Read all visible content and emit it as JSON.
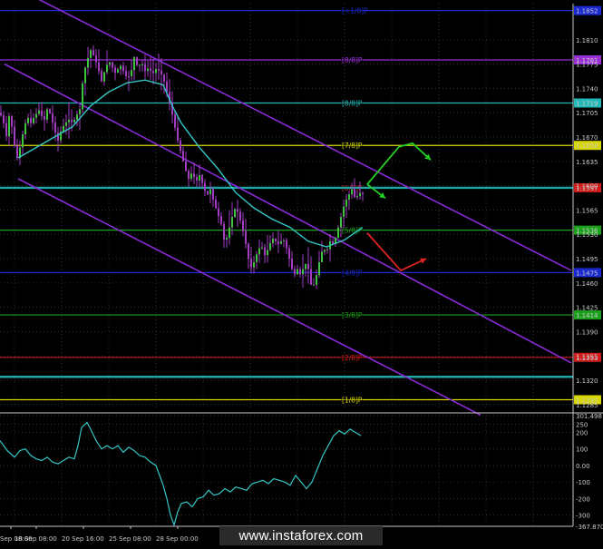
{
  "watermark": "www.instaforex.com",
  "colors": {
    "background": "#000000",
    "grid": "#2e2e2e",
    "candle": "#3cc43c",
    "candle_shadow": "#a23dc2",
    "ma": "#35c6c6",
    "channel": "#8a2bd6",
    "cci": "#35c6c6",
    "level_line": "#1fa6a6"
  },
  "chart_data": [
    {
      "type": "candlestick",
      "title": "",
      "instrument": "EUR/USD",
      "timeframe": "H4",
      "x_tick_labels": [
        "Sep 08:00",
        "18 Sep 08:00",
        "20 Sep 16:00",
        "25 Sep 08:00",
        "28 Sep 00:00"
      ],
      "y_tick_labels": [
        "1.1810",
        "1.1775",
        "1.1740",
        "1.1705",
        "1.1670",
        "1.1635",
        "1.1600",
        "1.1565",
        "1.1530",
        "1.1495",
        "1.1460",
        "1.1425",
        "1.1390",
        "1.1355",
        "1.1320",
        "1.1285"
      ],
      "ylim": [
        1.1277,
        1.1862
      ],
      "price_path": [
        [
          0,
          1.1705
        ],
        [
          4,
          1.169
        ],
        [
          8,
          1.1665
        ],
        [
          10,
          1.17
        ],
        [
          14,
          1.168
        ],
        [
          18,
          1.1635
        ],
        [
          22,
          1.1655
        ],
        [
          26,
          1.168
        ],
        [
          30,
          1.17
        ],
        [
          34,
          1.169
        ],
        [
          38,
          1.17
        ],
        [
          44,
          1.171
        ],
        [
          48,
          1.169
        ],
        [
          52,
          1.171
        ],
        [
          56,
          1.1702
        ],
        [
          60,
          1.168
        ],
        [
          64,
          1.1665
        ],
        [
          68,
          1.1682
        ],
        [
          72,
          1.169
        ],
        [
          76,
          1.1695
        ],
        [
          80,
          1.169
        ],
        [
          84,
          1.17
        ],
        [
          88,
          1.171
        ],
        [
          92,
          1.176
        ],
        [
          96,
          1.178
        ],
        [
          100,
          1.1795
        ],
        [
          104,
          1.1785
        ],
        [
          108,
          1.177
        ],
        [
          112,
          1.175
        ],
        [
          116,
          1.1768
        ],
        [
          120,
          1.178
        ],
        [
          124,
          1.177
        ],
        [
          128,
          1.176
        ],
        [
          132,
          1.1775
        ],
        [
          136,
          1.1765
        ],
        [
          140,
          1.1755
        ],
        [
          144,
          1.176
        ],
        [
          148,
          1.1785
        ],
        [
          152,
          1.177
        ],
        [
          156,
          1.1778
        ],
        [
          160,
          1.1765
        ],
        [
          164,
          1.177
        ],
        [
          168,
          1.176
        ],
        [
          172,
          1.1768
        ],
        [
          176,
          1.1765
        ],
        [
          180,
          1.1755
        ],
        [
          184,
          1.1735
        ],
        [
          188,
          1.1715
        ],
        [
          192,
          1.169
        ],
        [
          196,
          1.1665
        ],
        [
          200,
          1.1645
        ],
        [
          204,
          1.1625
        ],
        [
          208,
          1.161
        ],
        [
          212,
          1.162
        ],
        [
          216,
          1.1605
        ],
        [
          220,
          1.1615
        ],
        [
          224,
          1.16
        ],
        [
          228,
          1.1585
        ],
        [
          232,
          1.1595
        ],
        [
          236,
          1.1575
        ],
        [
          240,
          1.156
        ],
        [
          244,
          1.1545
        ],
        [
          248,
          1.1515
        ],
        [
          252,
          1.1535
        ],
        [
          256,
          1.1555
        ],
        [
          260,
          1.157
        ],
        [
          264,
          1.1555
        ],
        [
          268,
          1.1535
        ],
        [
          272,
          1.151
        ],
        [
          276,
          1.148
        ],
        [
          280,
          1.149
        ],
        [
          284,
          1.1505
        ],
        [
          288,
          1.1515
        ],
        [
          292,
          1.15
        ],
        [
          296,
          1.151
        ],
        [
          300,
          1.1525
        ],
        [
          304,
          1.152
        ],
        [
          308,
          1.1515
        ],
        [
          312,
          1.1525
        ],
        [
          316,
          1.151
        ],
        [
          320,
          1.149
        ],
        [
          324,
          1.147
        ],
        [
          328,
          1.148
        ],
        [
          332,
          1.147
        ],
        [
          336,
          1.149
        ],
        [
          340,
          1.148
        ],
        [
          344,
          1.145
        ],
        [
          348,
          1.1465
        ],
        [
          352,
          1.149
        ],
        [
          356,
          1.151
        ],
        [
          360,
          1.1505
        ],
        [
          364,
          1.152
        ],
        [
          368,
          1.1515
        ],
        [
          372,
          1.1535
        ],
        [
          376,
          1.1555
        ],
        [
          380,
          1.1575
        ],
        [
          384,
          1.1585
        ],
        [
          388,
          1.1595
        ],
        [
          392,
          1.158
        ],
        [
          396,
          1.159
        ],
        [
          400,
          1.1588
        ]
      ],
      "moving_average": [
        [
          20,
          1.164
        ],
        [
          40,
          1.1655
        ],
        [
          60,
          1.167
        ],
        [
          80,
          1.1685
        ],
        [
          100,
          1.1715
        ],
        [
          120,
          1.1735
        ],
        [
          140,
          1.1748
        ],
        [
          160,
          1.1752
        ],
        [
          180,
          1.1745
        ],
        [
          190,
          1.1715
        ],
        [
          200,
          1.169
        ],
        [
          220,
          1.1655
        ],
        [
          240,
          1.1625
        ],
        [
          260,
          1.159
        ],
        [
          280,
          1.1568
        ],
        [
          300,
          1.1552
        ],
        [
          320,
          1.154
        ],
        [
          340,
          1.152
        ],
        [
          360,
          1.1512
        ],
        [
          380,
          1.1522
        ],
        [
          400,
          1.154
        ]
      ],
      "regression_channel": {
        "upper": [
          [
            40,
            1.187
          ],
          [
            630,
            1.1478
          ]
        ],
        "middle": [
          [
            5,
            1.1775
          ],
          [
            630,
            1.1345
          ]
        ],
        "lower": [
          [
            20,
            1.161
          ],
          [
            530,
            1.127
          ]
        ]
      },
      "murrey_levels": [
        {
          "label": "[+1/8]P",
          "value": 1.1852,
          "price_label": "1.1852",
          "color": "#1a2ad0"
        },
        {
          "label": "[8/8]P",
          "value": 1.1781,
          "price_label": "1.1781",
          "color": "#9a2fd8"
        },
        {
          "label": "[8/8]P",
          "value": 1.1719,
          "price_label": "1.1719",
          "color": "#22b8b8"
        },
        {
          "label": "[7/8]P",
          "value": 1.1658,
          "price_label": "1.1658",
          "color": "#d8d800"
        },
        {
          "label": "[6/8]P",
          "value": 1.1597,
          "price_label": "1.1597",
          "color": "#d01a1a"
        },
        {
          "label": "[5/8]P",
          "value": 1.1536,
          "price_label": "1.1536",
          "color": "#1aa01a"
        },
        {
          "label": "[4/8]P",
          "value": 1.1475,
          "price_label": "1.1475",
          "color": "#1a2ad0"
        },
        {
          "label": "[3/8]P",
          "value": 1.1414,
          "price_label": "1.1414",
          "color": "#1aa01a"
        },
        {
          "label": "[2/8]P",
          "value": 1.1353,
          "price_label": "1.1353",
          "color": "#d01a1a"
        },
        {
          "label": "[1/8]P",
          "value": 1.1292,
          "price_label": "1.1292",
          "color": "#d8d800"
        }
      ],
      "current_price": 1.1597,
      "cyan_horizontal_lines": [
        1.1597,
        1.1325
      ],
      "arrows": [
        {
          "color": "#22cc22",
          "direction": "up",
          "points": [
            [
              405,
              1.1602
            ],
            [
              440,
              1.1656
            ],
            [
              455,
              1.1661
            ],
            [
              475,
              1.1637
            ]
          ]
        },
        {
          "color": "#22cc22",
          "direction": "down",
          "points": [
            [
              405,
              1.1602
            ],
            [
              425,
              1.1582
            ]
          ]
        },
        {
          "color": "#dd2222",
          "direction": "down",
          "points": [
            [
              405,
              1.1532
            ],
            [
              442,
              1.1478
            ],
            [
              470,
              1.1495
            ]
          ]
        }
      ]
    },
    {
      "type": "line",
      "indicator": "CCI",
      "title": "",
      "y_tick_labels": [
        "301.498",
        "250",
        "200",
        "100",
        "0.00",
        "-100",
        "-200",
        "-300",
        "-367.870"
      ],
      "ylim": [
        -367.87,
        301.498
      ],
      "series": [
        {
          "values": [
            [
              0,
              150
            ],
            [
              8,
              90
            ],
            [
              16,
              50
            ],
            [
              22,
              90
            ],
            [
              28,
              100
            ],
            [
              34,
              60
            ],
            [
              40,
              40
            ],
            [
              46,
              30
            ],
            [
              52,
              50
            ],
            [
              58,
              20
            ],
            [
              64,
              10
            ],
            [
              70,
              30
            ],
            [
              76,
              50
            ],
            [
              82,
              40
            ],
            [
              86,
              120
            ],
            [
              90,
              230
            ],
            [
              96,
              260
            ],
            [
              100,
              220
            ],
            [
              106,
              150
            ],
            [
              112,
              100
            ],
            [
              118,
              120
            ],
            [
              124,
              100
            ],
            [
              130,
              120
            ],
            [
              136,
              80
            ],
            [
              142,
              110
            ],
            [
              148,
              90
            ],
            [
              154,
              60
            ],
            [
              160,
              50
            ],
            [
              166,
              20
            ],
            [
              172,
              0
            ],
            [
              176,
              -60
            ],
            [
              180,
              -120
            ],
            [
              184,
              -200
            ],
            [
              188,
              -300
            ],
            [
              192,
              -360
            ],
            [
              196,
              -280
            ],
            [
              200,
              -230
            ],
            [
              206,
              -220
            ],
            [
              212,
              -250
            ],
            [
              218,
              -200
            ],
            [
              224,
              -190
            ],
            [
              230,
              -150
            ],
            [
              236,
              -180
            ],
            [
              242,
              -170
            ],
            [
              248,
              -140
            ],
            [
              254,
              -160
            ],
            [
              260,
              -130
            ],
            [
              266,
              -140
            ],
            [
              272,
              -150
            ],
            [
              278,
              -110
            ],
            [
              284,
              -100
            ],
            [
              290,
              -90
            ],
            [
              296,
              -110
            ],
            [
              302,
              -80
            ],
            [
              308,
              -90
            ],
            [
              314,
              -100
            ],
            [
              320,
              -120
            ],
            [
              326,
              -60
            ],
            [
              332,
              -100
            ],
            [
              338,
              -140
            ],
            [
              344,
              -100
            ],
            [
              350,
              -20
            ],
            [
              356,
              60
            ],
            [
              362,
              120
            ],
            [
              368,
              180
            ],
            [
              374,
              210
            ],
            [
              380,
              190
            ],
            [
              386,
              220
            ],
            [
              392,
              200
            ],
            [
              398,
              180
            ]
          ]
        }
      ]
    }
  ]
}
